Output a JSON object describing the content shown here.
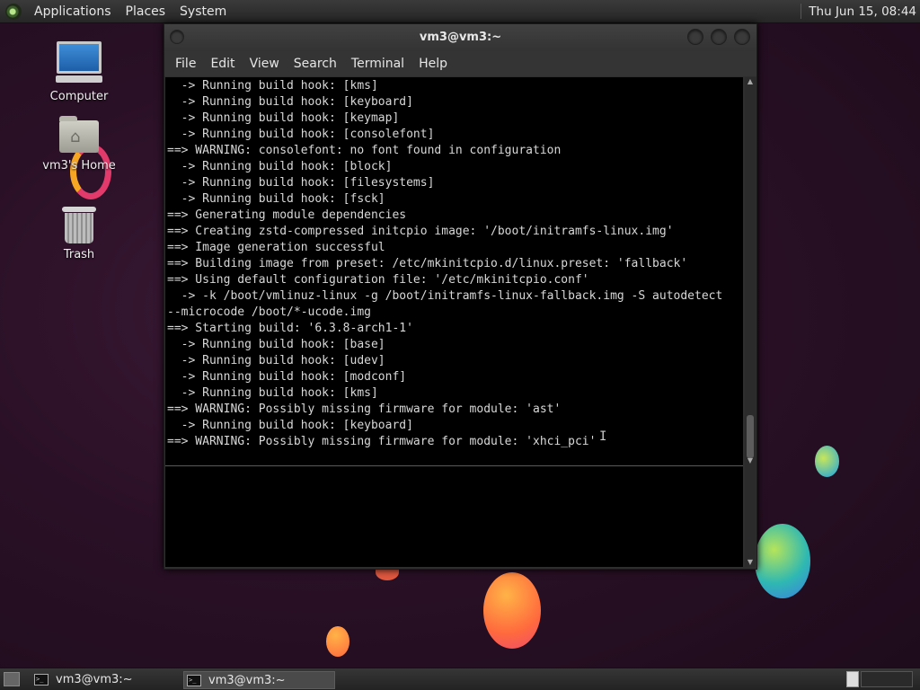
{
  "top_panel": {
    "menus": [
      "Applications",
      "Places",
      "System"
    ],
    "clock": "Thu Jun 15, 08:44"
  },
  "desktop": {
    "icons": [
      {
        "label": "Computer",
        "icon": "computer-icon"
      },
      {
        "label": "vm3's Home",
        "icon": "home-folder-icon"
      },
      {
        "label": "Trash",
        "icon": "trash-icon"
      }
    ]
  },
  "window": {
    "title": "vm3@vm3:~",
    "menu": [
      "File",
      "Edit",
      "View",
      "Search",
      "Terminal",
      "Help"
    ]
  },
  "terminal": {
    "lines": [
      "  -> Running build hook: [kms]",
      "  -> Running build hook: [keyboard]",
      "  -> Running build hook: [keymap]",
      "  -> Running build hook: [consolefont]",
      "==> WARNING: consolefont: no font found in configuration",
      "  -> Running build hook: [block]",
      "  -> Running build hook: [filesystems]",
      "  -> Running build hook: [fsck]",
      "==> Generating module dependencies",
      "==> Creating zstd-compressed initcpio image: '/boot/initramfs-linux.img'",
      "==> Image generation successful",
      "==> Building image from preset: /etc/mkinitcpio.d/linux.preset: 'fallback'",
      "==> Using default configuration file: '/etc/mkinitcpio.conf'",
      "  -> -k /boot/vmlinuz-linux -g /boot/initramfs-linux-fallback.img -S autodetect",
      "--microcode /boot/*-ucode.img",
      "==> Starting build: '6.3.8-arch1-1'",
      "  -> Running build hook: [base]",
      "  -> Running build hook: [udev]",
      "  -> Running build hook: [modconf]",
      "  -> Running build hook: [kms]",
      "==> WARNING: Possibly missing firmware for module: 'ast'",
      "  -> Running build hook: [keyboard]",
      "==> WARNING: Possibly missing firmware for module: 'xhci_pci'"
    ]
  },
  "taskbar": {
    "tasks": [
      {
        "label": "vm3@vm3:~",
        "active": false
      },
      {
        "label": "vm3@vm3:~",
        "active": true
      }
    ]
  },
  "colors": {
    "terminal_bg": "#000000",
    "terminal_fg": "#d8d8d8",
    "desktop_bg": "#2a1026"
  }
}
